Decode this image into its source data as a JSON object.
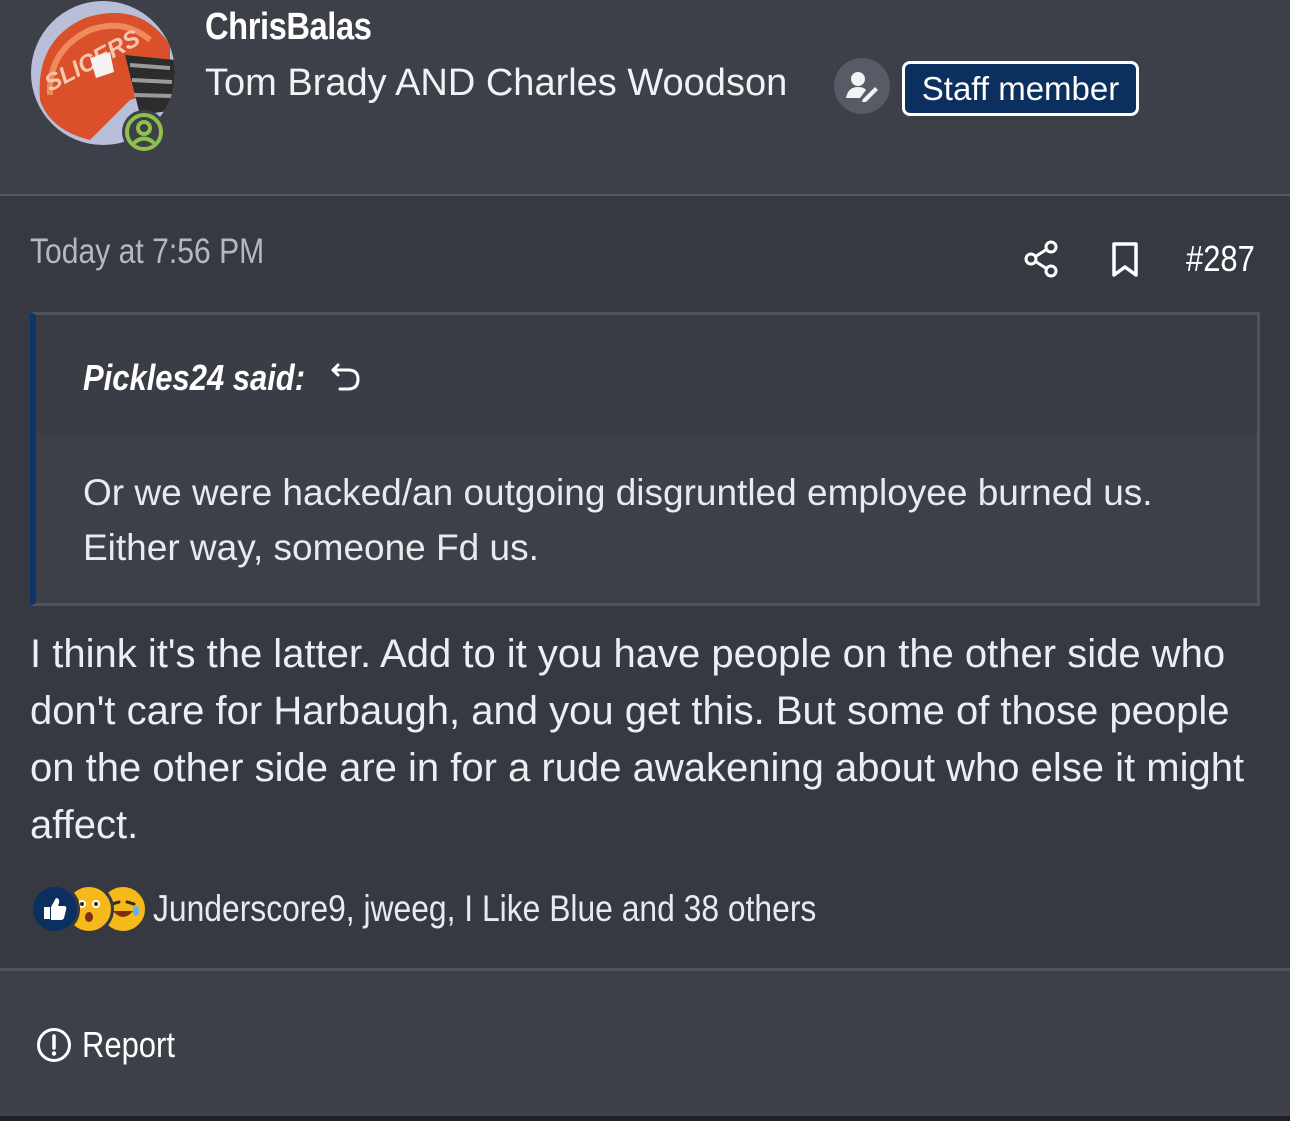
{
  "author": {
    "name": "ChrisBalas",
    "title": "Tom Brady AND Charles Woodson",
    "badge": "Staff member",
    "avatar_icon": "helmet-avatar",
    "online_icon": "online-status-icon"
  },
  "post": {
    "time": "Today at 7:56 PM",
    "number": "#287",
    "quote": {
      "author": "Pickles24 said:",
      "text": "Or we were hacked/an outgoing disgruntled employee burned us. Either way, someone Fd us."
    },
    "body": "I think it's the latter. Add to it you have people on the other side who don't care for Harbaugh, and you get this. But some of those people on the other side are in for a rude awakening about who else it might affect.",
    "reactions": {
      "icons": [
        "like-icon",
        "wow-icon",
        "haha-icon"
      ],
      "text": "Junderscore9, jweeg, I Like Blue and 38 others"
    }
  },
  "actions": {
    "report": "Report"
  },
  "colors": {
    "background": "#363941",
    "panel": "#3d4048",
    "accent": "#0b2f5e",
    "online": "#8bc34a"
  }
}
